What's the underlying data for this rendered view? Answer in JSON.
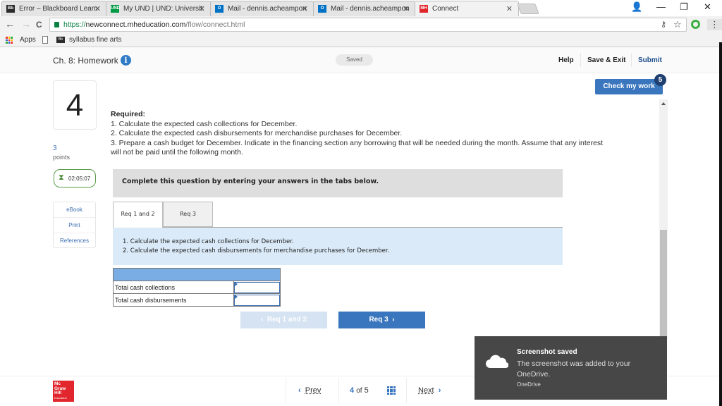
{
  "browser": {
    "tabs": [
      {
        "label": "Error – Blackboard Learn",
        "favicon": "Bb",
        "favicon_color": "#2b2b2b",
        "active": false
      },
      {
        "label": "My UND | UND: Universit",
        "favicon": "UND",
        "favicon_color": "#009a44",
        "active": false
      },
      {
        "label": "Mail - dennis.acheampon",
        "favicon": "O",
        "favicon_color": "#0072c6",
        "active": false
      },
      {
        "label": "Mail - dennis.acheampon",
        "favicon": "O",
        "favicon_color": "#0072c6",
        "active": false
      },
      {
        "label": "Connect",
        "favicon": "MH",
        "favicon_color": "#e1262d",
        "active": true
      }
    ],
    "close_glyph": "✕",
    "window_controls": {
      "profile": "👤",
      "minimize": "—",
      "restore": "❐",
      "close": "✕"
    },
    "url": {
      "scheme": "https://",
      "host": "newconnect.mheducation.com",
      "path": "/flow/connect.html"
    },
    "nav": {
      "back": "←",
      "forward": "→",
      "reload": "C"
    },
    "omni_icons": {
      "key": "⚷",
      "star": "☆",
      "menu": "⋮"
    },
    "bookmarks": [
      {
        "label": "Apps",
        "icon": "apps-grid-icon"
      },
      {
        "label": "",
        "icon": "page-icon"
      },
      {
        "label": "syllabus fine arts",
        "icon": "blackboard-icon"
      }
    ]
  },
  "header": {
    "title": "Ch. 8: Homework",
    "info_glyph": "i",
    "saved_status": "Saved",
    "links": {
      "help": "Help",
      "save_exit": "Save & Exit",
      "submit": "Submit"
    }
  },
  "question": {
    "number": "4",
    "points_value": "3",
    "points_label": "points",
    "timer": "02:05:07",
    "tools": [
      "eBook",
      "Print",
      "References"
    ],
    "required_heading": "Required:",
    "required_items": [
      "1. Calculate the expected cash collections for December.",
      "2. Calculate the expected cash disbursements for merchandise purchases for December.",
      "3. Prepare a cash budget for December. Indicate in the financing section any borrowing that will be needed during the month. Assume that any interest will not be paid until the following month."
    ],
    "complete_banner": "Complete this question by entering your answers in the tabs below.",
    "tabs": [
      {
        "label": "Req 1 and 2",
        "active": true
      },
      {
        "label": "Req 3",
        "active": false
      }
    ],
    "instructions": [
      "1. Calculate the expected cash collections for December.",
      "2. Calculate the expected cash disbursements for merchandise purchases for December."
    ],
    "answer_rows": [
      {
        "label": "Total cash collections",
        "value": ""
      },
      {
        "label": "Total cash disbursements",
        "value": ""
      }
    ],
    "prev_req": "Req 1 and 2",
    "next_req": "Req 3"
  },
  "check_work": {
    "label": "Check my work",
    "remaining": "5"
  },
  "footer": {
    "logo_lines": [
      "Mc",
      "Graw",
      "Hill",
      "Education"
    ],
    "prev": "Prev",
    "current": "4",
    "of": "of",
    "total": "5",
    "next": "Next"
  },
  "toast": {
    "title": "Screenshot saved",
    "body": "The screenshot was added to your OneDrive.",
    "source": "OneDrive"
  }
}
